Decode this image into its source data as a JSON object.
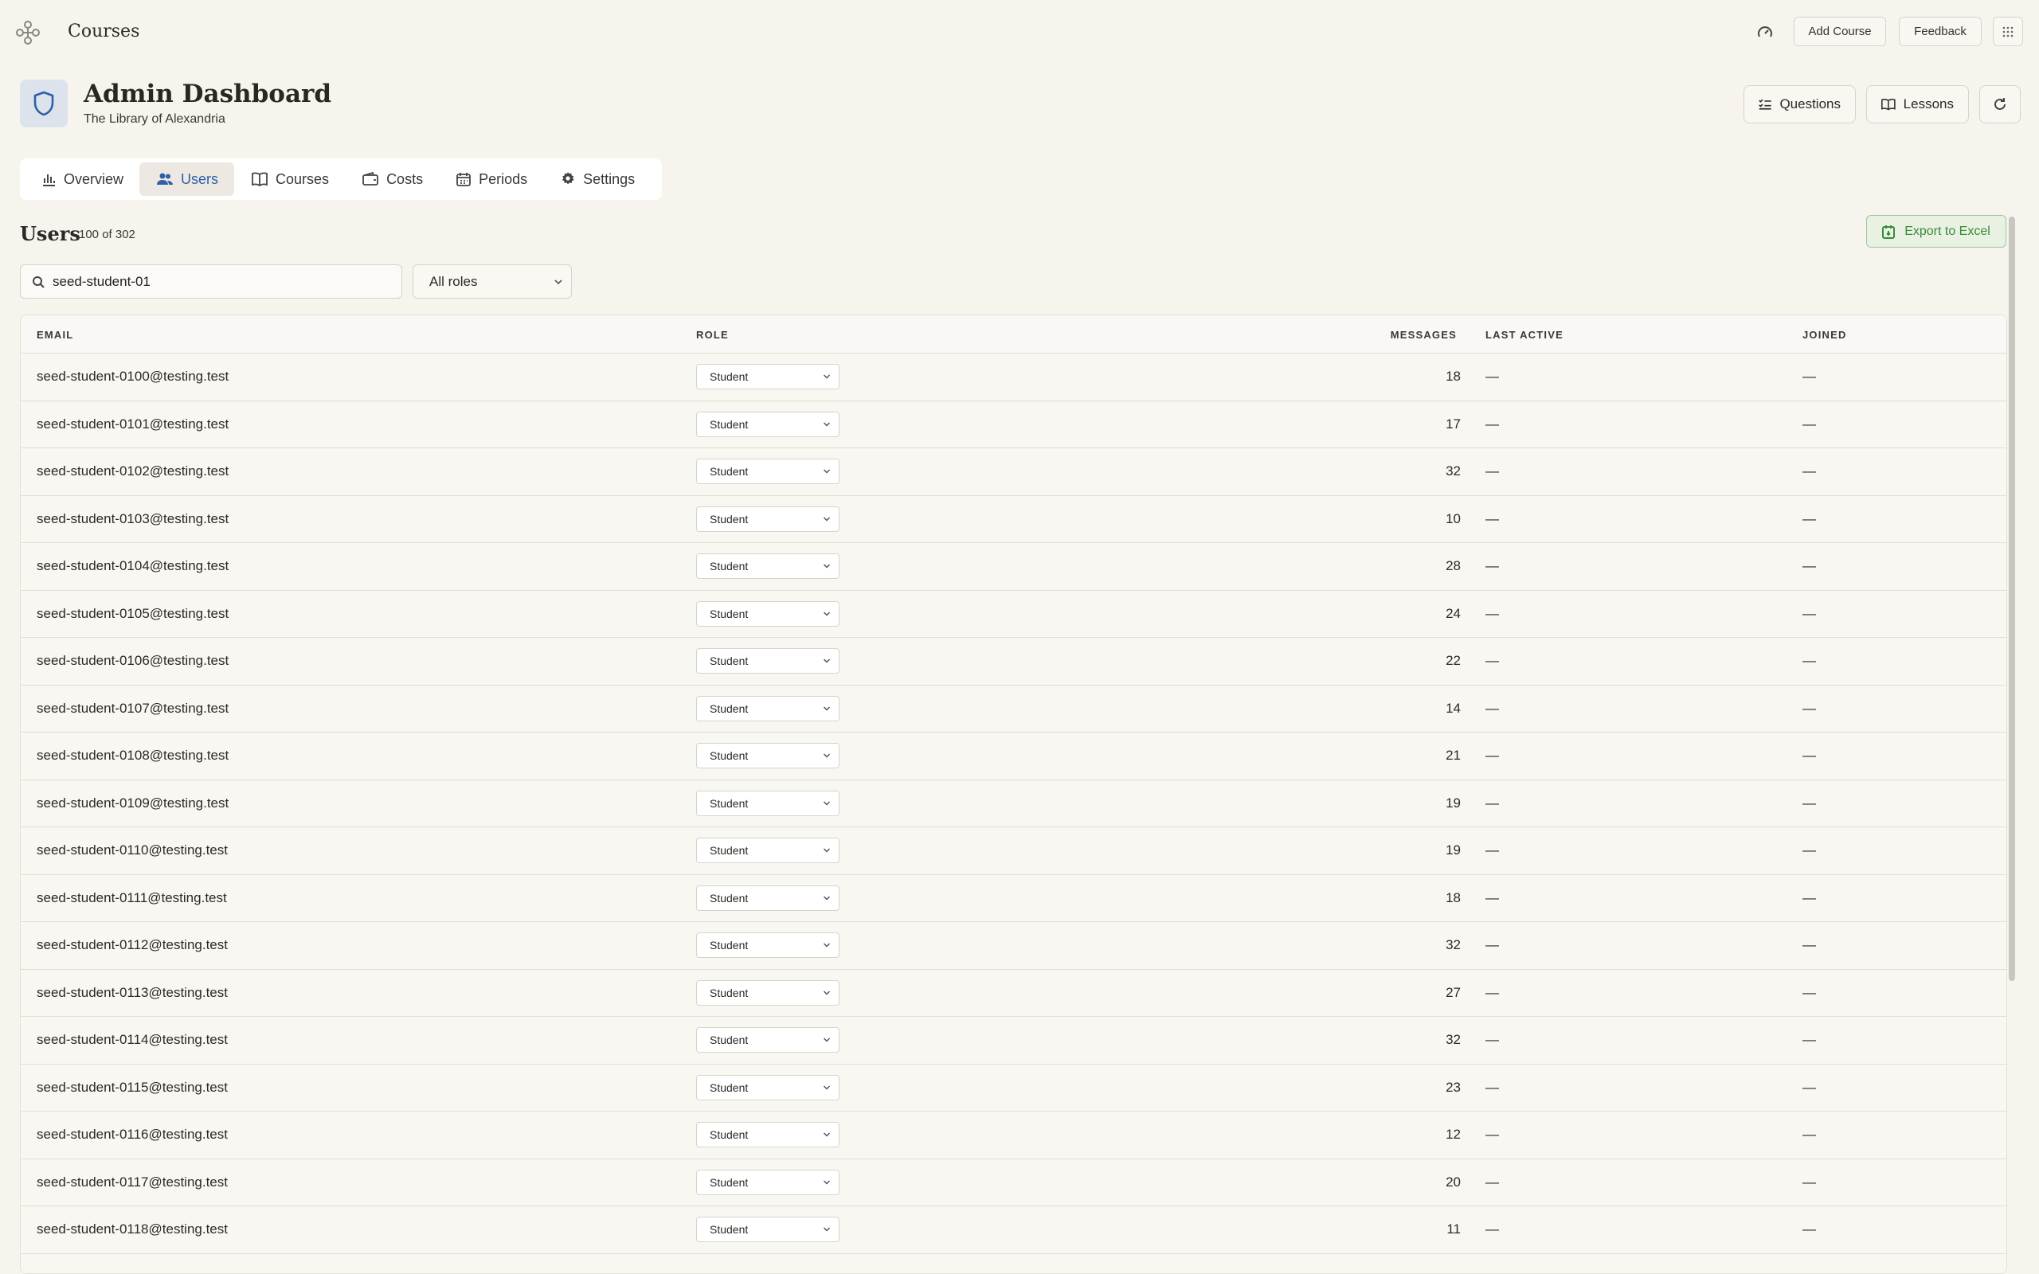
{
  "topbar": {
    "title": "Courses",
    "add_course_label": "Add Course",
    "feedback_label": "Feedback"
  },
  "header": {
    "title": "Admin Dashboard",
    "subtitle": "The Library of Alexandria",
    "questions_label": "Questions",
    "lessons_label": "Lessons"
  },
  "tabs": [
    {
      "label": "Overview",
      "icon": "bar-chart-icon",
      "active": false
    },
    {
      "label": "Users",
      "icon": "users-icon",
      "active": true
    },
    {
      "label": "Courses",
      "icon": "book-icon",
      "active": false
    },
    {
      "label": "Costs",
      "icon": "wallet-icon",
      "active": false
    },
    {
      "label": "Periods",
      "icon": "calendar-icon",
      "active": false
    },
    {
      "label": "Settings",
      "icon": "gear-icon",
      "active": false
    }
  ],
  "users": {
    "title": "Users",
    "count": "100 of 302",
    "export_label": "Export to Excel",
    "search_value": "seed-student-01",
    "role_filter": "All roles"
  },
  "table": {
    "columns": [
      "EMAIL",
      "ROLE",
      "MESSAGES",
      "LAST ACTIVE",
      "JOINED"
    ],
    "rows": [
      {
        "email": "seed-student-0100@testing.test",
        "role": "Student",
        "messages": "18",
        "last_active": "—",
        "joined": "—"
      },
      {
        "email": "seed-student-0101@testing.test",
        "role": "Student",
        "messages": "17",
        "last_active": "—",
        "joined": "—"
      },
      {
        "email": "seed-student-0102@testing.test",
        "role": "Student",
        "messages": "32",
        "last_active": "—",
        "joined": "—"
      },
      {
        "email": "seed-student-0103@testing.test",
        "role": "Student",
        "messages": "10",
        "last_active": "—",
        "joined": "—"
      },
      {
        "email": "seed-student-0104@testing.test",
        "role": "Student",
        "messages": "28",
        "last_active": "—",
        "joined": "—"
      },
      {
        "email": "seed-student-0105@testing.test",
        "role": "Student",
        "messages": "24",
        "last_active": "—",
        "joined": "—"
      },
      {
        "email": "seed-student-0106@testing.test",
        "role": "Student",
        "messages": "22",
        "last_active": "—",
        "joined": "—"
      },
      {
        "email": "seed-student-0107@testing.test",
        "role": "Student",
        "messages": "14",
        "last_active": "—",
        "joined": "—"
      },
      {
        "email": "seed-student-0108@testing.test",
        "role": "Student",
        "messages": "21",
        "last_active": "—",
        "joined": "—"
      },
      {
        "email": "seed-student-0109@testing.test",
        "role": "Student",
        "messages": "19",
        "last_active": "—",
        "joined": "—"
      },
      {
        "email": "seed-student-0110@testing.test",
        "role": "Student",
        "messages": "19",
        "last_active": "—",
        "joined": "—"
      },
      {
        "email": "seed-student-0111@testing.test",
        "role": "Student",
        "messages": "18",
        "last_active": "—",
        "joined": "—"
      },
      {
        "email": "seed-student-0112@testing.test",
        "role": "Student",
        "messages": "32",
        "last_active": "—",
        "joined": "—"
      },
      {
        "email": "seed-student-0113@testing.test",
        "role": "Student",
        "messages": "27",
        "last_active": "—",
        "joined": "—"
      },
      {
        "email": "seed-student-0114@testing.test",
        "role": "Student",
        "messages": "32",
        "last_active": "—",
        "joined": "—"
      },
      {
        "email": "seed-student-0115@testing.test",
        "role": "Student",
        "messages": "23",
        "last_active": "—",
        "joined": "—"
      },
      {
        "email": "seed-student-0116@testing.test",
        "role": "Student",
        "messages": "12",
        "last_active": "—",
        "joined": "—"
      },
      {
        "email": "seed-student-0117@testing.test",
        "role": "Student",
        "messages": "20",
        "last_active": "—",
        "joined": "—"
      },
      {
        "email": "seed-student-0118@testing.test",
        "role": "Student",
        "messages": "11",
        "last_active": "—",
        "joined": "—"
      }
    ]
  },
  "colors": {
    "background": "#f7f4ee",
    "accent_blue": "#2e5fa8",
    "export_green": "#3a8a3a"
  }
}
